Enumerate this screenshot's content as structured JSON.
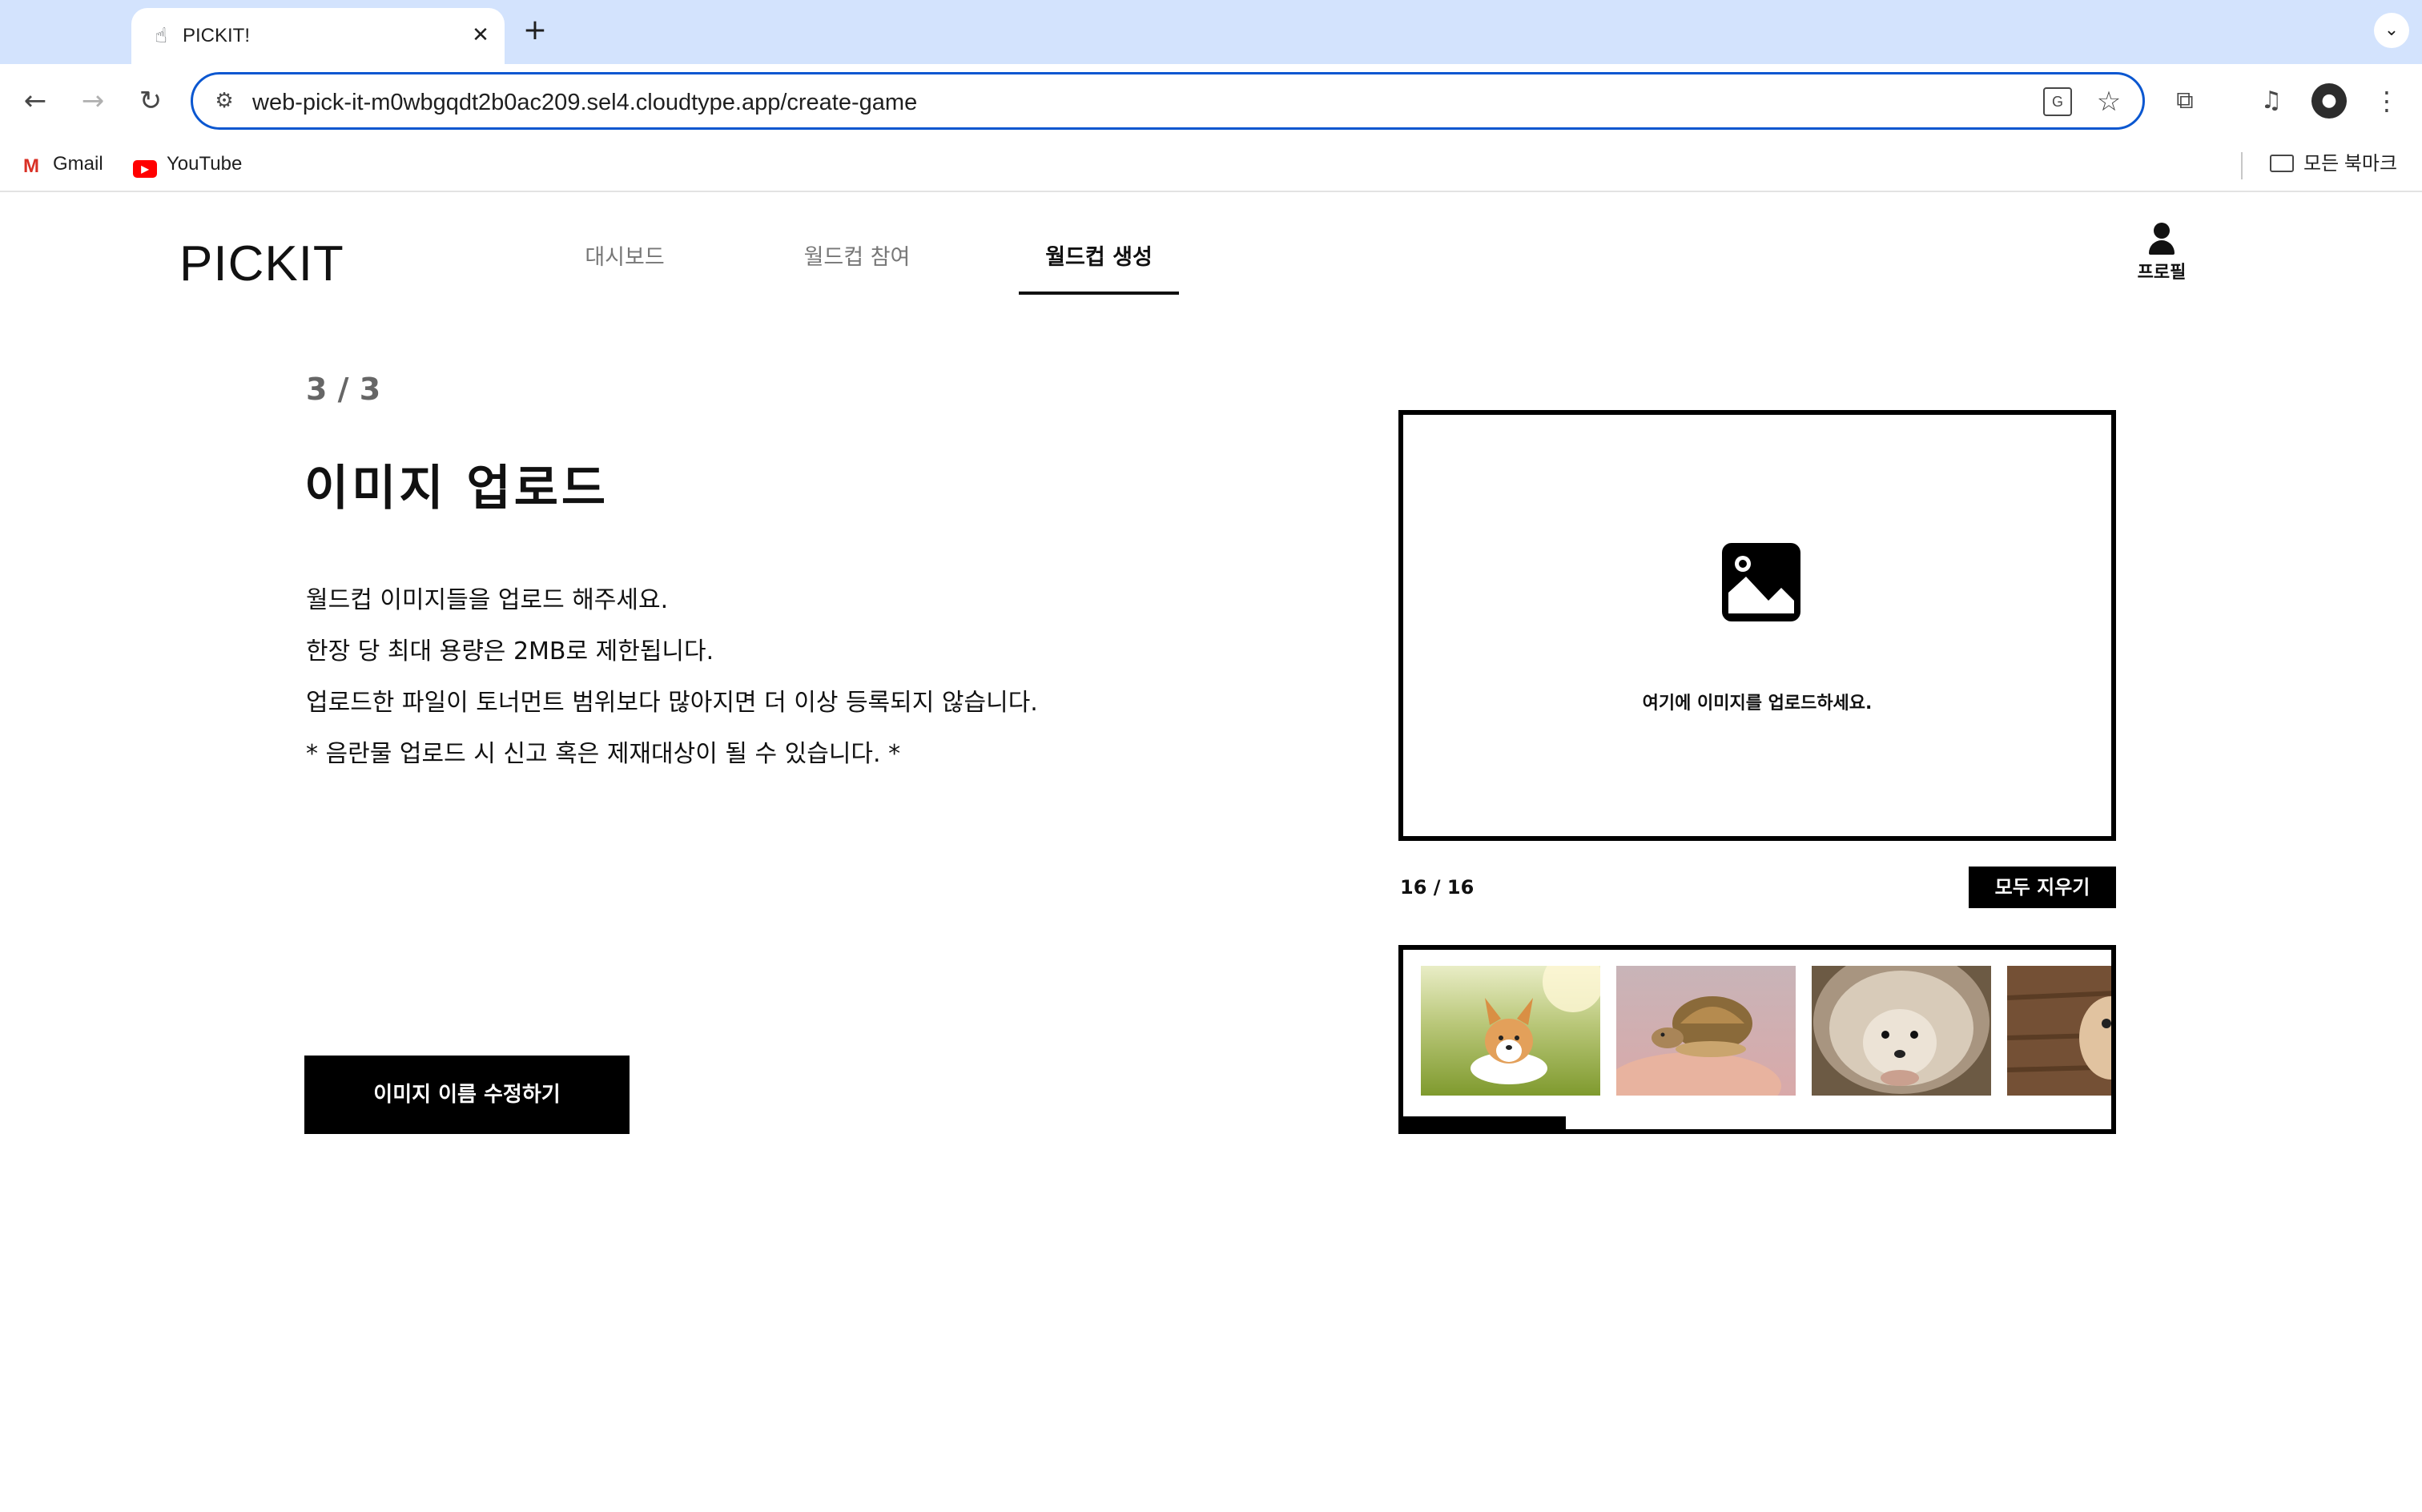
{
  "browser": {
    "tab": {
      "title": "PICKIT!",
      "favicon": "pointer-hand-icon"
    },
    "url": "web-pick-it-m0wbgqdt2b0ac209.sel4.cloudtype.app/create-game",
    "bookmarks": [
      {
        "label": "Gmail",
        "icon": "gmail-icon"
      },
      {
        "label": "YouTube",
        "icon": "youtube-icon"
      }
    ],
    "all_bookmarks_label": "모든 북마크"
  },
  "header": {
    "logo": "PICKIT",
    "nav": [
      {
        "label": "대시보드",
        "active": false
      },
      {
        "label": "월드컵 참여",
        "active": false
      },
      {
        "label": "월드컵 생성",
        "active": true
      }
    ],
    "profile_label": "프로필"
  },
  "main": {
    "step": "3 / 3",
    "heading": "이미지 업로드",
    "description": [
      "월드컵 이미지들을 업로드 해주세요.",
      "한장 당 최대 용량은 2MB로 제한됩니다.",
      "업로드한 파일이 토너먼트 범위보다 많아지면 더 이상 등록되지 않습니다.",
      "* 음란물 업로드 시 신고 혹은 제재대상이 될 수 있습니다. *"
    ],
    "rename_button": "이미지 이름 수정하기"
  },
  "upload": {
    "dropzone_label": "여기에 이미지를 업로드하세요.",
    "count": "16 / 16",
    "clear_button": "모두 지우기",
    "strip_scroll_fraction": 0.23,
    "thumbnails": [
      {
        "subject": "corgi"
      },
      {
        "subject": "tortoise"
      },
      {
        "subject": "hedgehog"
      },
      {
        "subject": "hamster"
      }
    ]
  },
  "colors": {
    "accent": "#0b57d0",
    "tabbar": "#d3e3fd",
    "primary": "#000000"
  }
}
